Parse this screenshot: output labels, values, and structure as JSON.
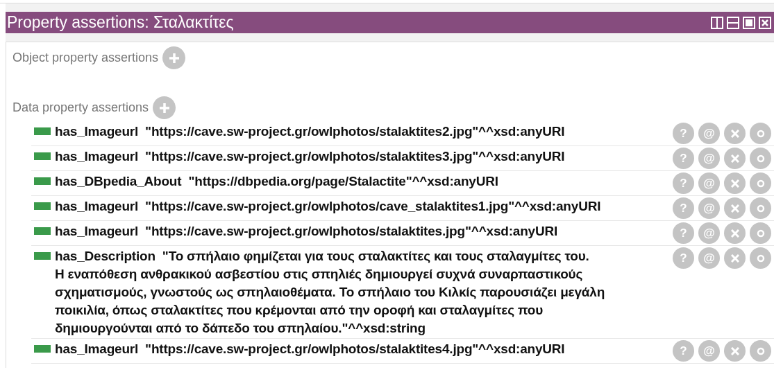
{
  "panel": {
    "title": "Property assertions: Σταλακτίτες"
  },
  "sections": [
    {
      "label": "Object property assertions"
    },
    {
      "label": "Data property assertions",
      "rows": [
        {
          "property": "has_Imageurl",
          "value": [
            "\"https://cave.sw-project.gr/owlphotos/stalaktites2.jpg\"^^xsd:anyURI"
          ],
          "help": "?",
          "annotate": "@"
        },
        {
          "property": "has_Imageurl",
          "value": [
            "\"https://cave.sw-project.gr/owlphotos/stalaktites3.jpg\"^^xsd:anyURI"
          ],
          "help": "?",
          "annotate": "@"
        },
        {
          "property": "has_DBpedia_About",
          "value": [
            "\"https://dbpedia.org/page/Stalactite\"^^xsd:anyURI"
          ],
          "help": "?",
          "annotate": "@"
        },
        {
          "property": "has_Imageurl",
          "value": [
            "\"https://cave.sw-project.gr/owlphotos/cave_stalaktites1.jpg\"^^xsd:anyURI"
          ],
          "help": "?",
          "annotate": "@"
        },
        {
          "property": "has_Imageurl",
          "value": [
            "\"https://cave.sw-project.gr/owlphotos/stalaktites.jpg\"^^xsd:anyURI"
          ],
          "help": "?",
          "annotate": "@"
        },
        {
          "property": "has_Description",
          "value": [
            "\"Το σπήλαιο φημίζεται για τους σταλακτίτες και τους σταλαγμίτες του.",
            "Η εναπόθεση ανθρακικού ασβεστίου στις σπηλιές δημιουργεί συχνά συναρπαστικούς",
            "σχηματισμούς, γνωστούς ως σπηλαιοθέματα. Το σπήλαιο του Κιλκίς παρουσιάζει μεγάλη",
            "ποικιλία, όπως σταλακτίτες που κρέμονται από την οροφή και σταλαγμίτες που",
            "δημιουργούνται από το δάπεδο του σπηλαίου.\"^^xsd:string"
          ],
          "help": "?",
          "annotate": "@"
        },
        {
          "property": "has_Imageurl",
          "value": [
            "\"https://cave.sw-project.gr/owlphotos/stalaktites4.jpg\"^^xsd:anyURI"
          ],
          "help": "?",
          "annotate": "@"
        }
      ]
    }
  ]
}
